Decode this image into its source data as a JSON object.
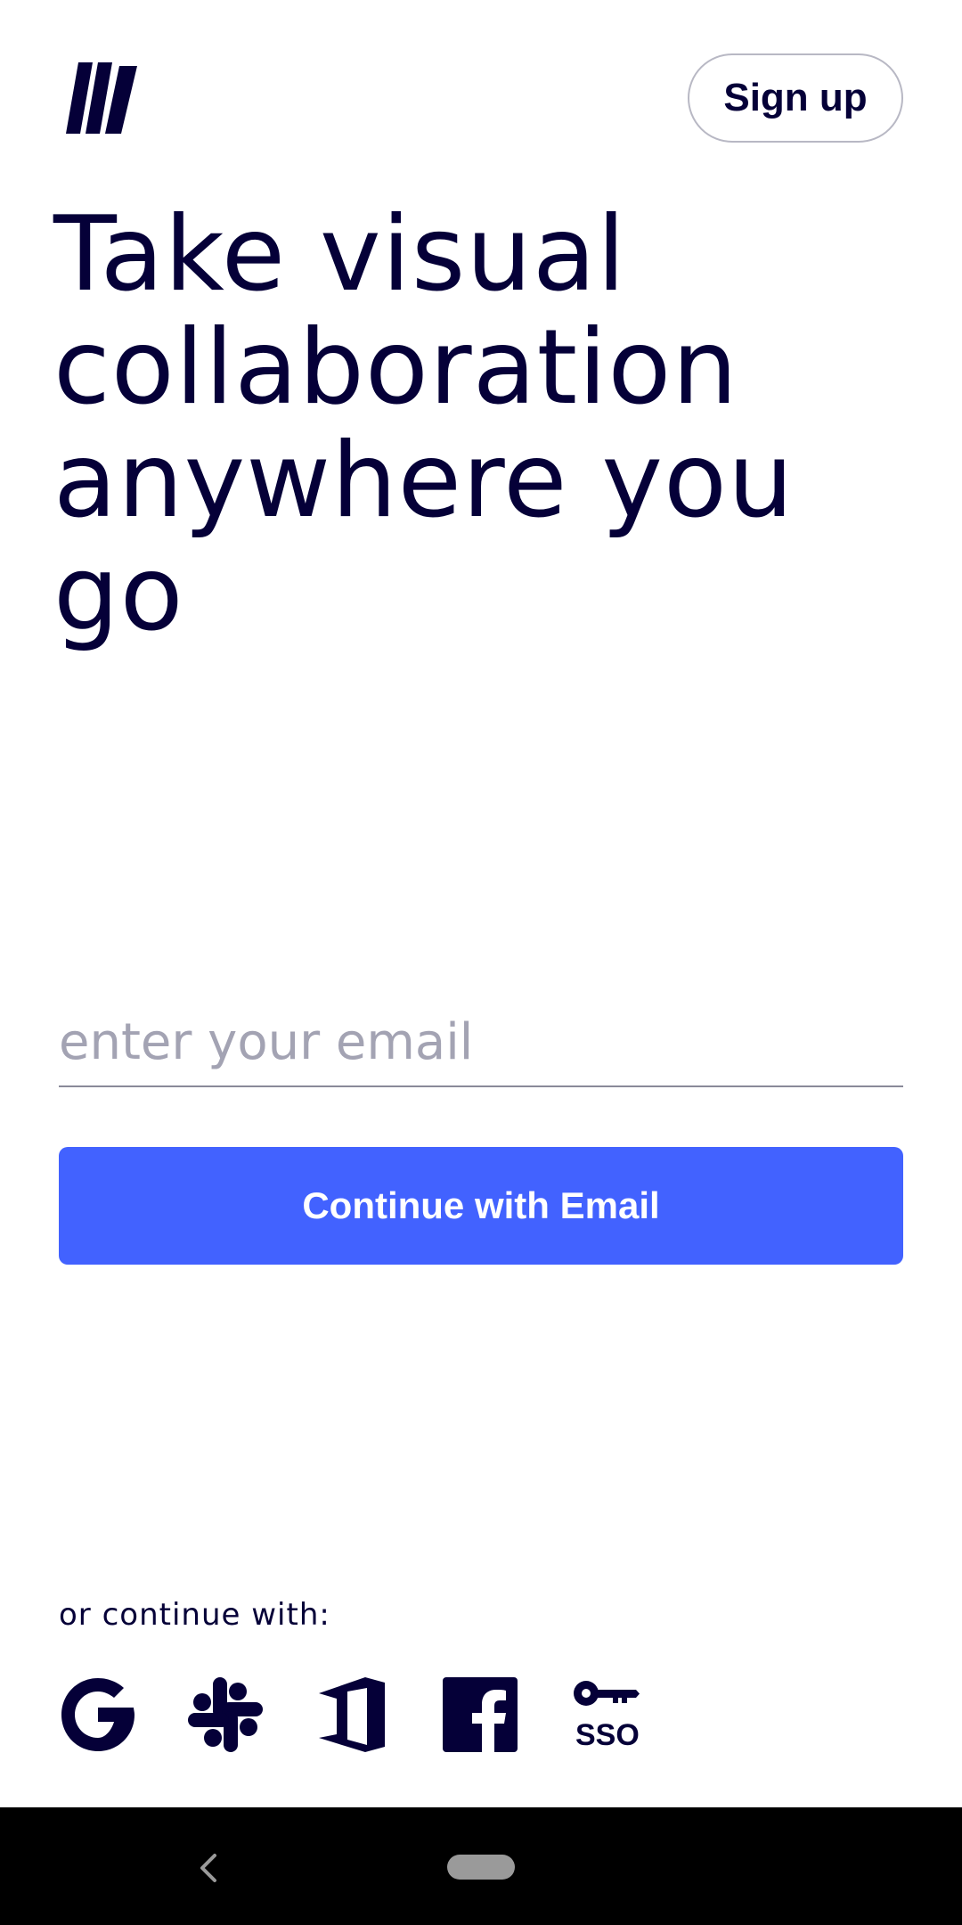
{
  "header": {
    "logo_name": "miro-logo",
    "signup_label": "Sign up"
  },
  "hero": {
    "headline": "Take visual collaboration anywhere you go"
  },
  "email": {
    "placeholder": "enter your email",
    "value": ""
  },
  "continue": {
    "label": "Continue with Email"
  },
  "alt_login": {
    "label": "or continue with:",
    "providers": [
      {
        "name": "google",
        "icon": "google-icon"
      },
      {
        "name": "slack",
        "icon": "slack-icon"
      },
      {
        "name": "office",
        "icon": "office-icon"
      },
      {
        "name": "facebook",
        "icon": "facebook-icon"
      },
      {
        "name": "sso",
        "icon": "key-icon",
        "label": "SSO"
      }
    ]
  },
  "colors": {
    "ink": "#050038",
    "accent": "#4262ff",
    "placeholder": "#a3a3b3",
    "background": "#ffffff",
    "navbar": "#000000"
  },
  "system_nav": {
    "back_icon": "chevron-left-icon",
    "home_icon": "home-pill-icon"
  }
}
